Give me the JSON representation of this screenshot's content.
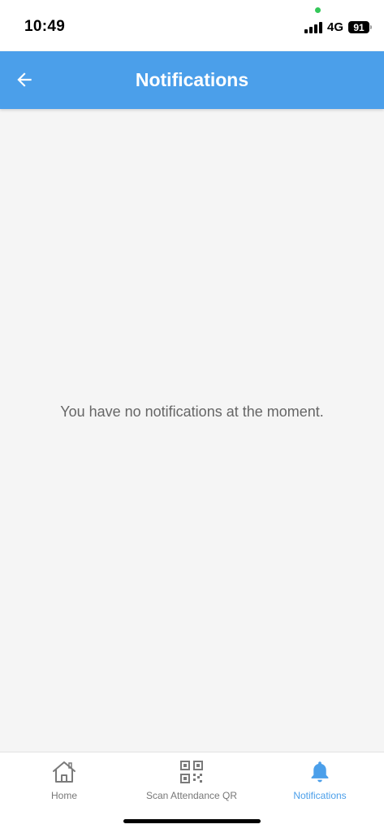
{
  "status_bar": {
    "time": "10:49",
    "network": "4G",
    "battery": "91"
  },
  "header": {
    "title": "Notifications",
    "back_icon": "arrow-left-icon"
  },
  "main": {
    "empty_message": "You have no notifications at the moment."
  },
  "bottom_nav": {
    "items": [
      {
        "label": "Home",
        "icon": "home-icon",
        "active": false
      },
      {
        "label": "Scan Attendance QR",
        "icon": "qr-code-icon",
        "active": false
      },
      {
        "label": "Notifications",
        "icon": "bell-icon",
        "active": true
      }
    ]
  },
  "colors": {
    "primary": "#4b9fea",
    "background": "#f5f5f5",
    "inactive": "#777777"
  }
}
